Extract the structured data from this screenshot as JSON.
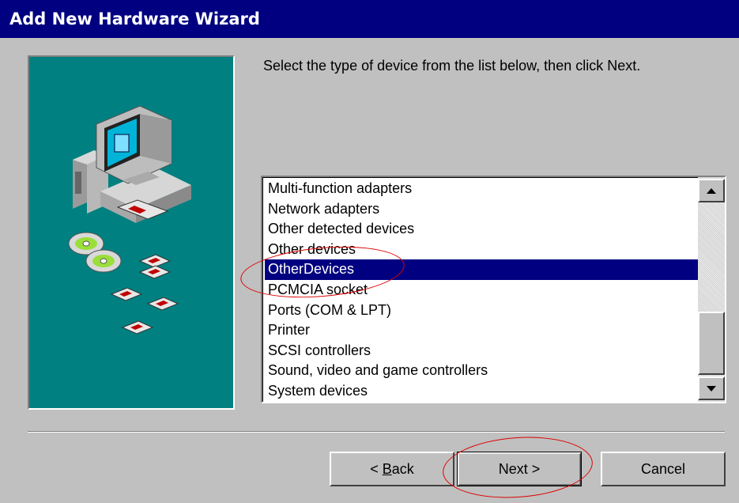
{
  "window": {
    "title": "Add New Hardware Wizard"
  },
  "instruction": "Select the type of device from the list below, then click Next.",
  "device_list": {
    "items": [
      "Multi-function adapters",
      "Network adapters",
      "Other detected devices",
      "Other devices",
      "OtherDevices",
      "PCMCIA socket",
      "Ports (COM & LPT)",
      "Printer",
      "SCSI controllers",
      "Sound, video and game controllers",
      "System devices"
    ],
    "selected_index": 4
  },
  "buttons": {
    "back_label_pre": "< ",
    "back_label_accel": "B",
    "back_label_post": "ack",
    "next_label": "Next >",
    "cancel_label": "Cancel"
  },
  "colors": {
    "title_bar": "#000080",
    "side_panel": "#008080",
    "selection": "#000080",
    "annotation": "#e00000"
  },
  "icons": [
    "computer-icon",
    "cd-rom-icon",
    "floppy-disk-icon",
    "scroll-up-arrow-icon",
    "scroll-down-arrow-icon"
  ]
}
